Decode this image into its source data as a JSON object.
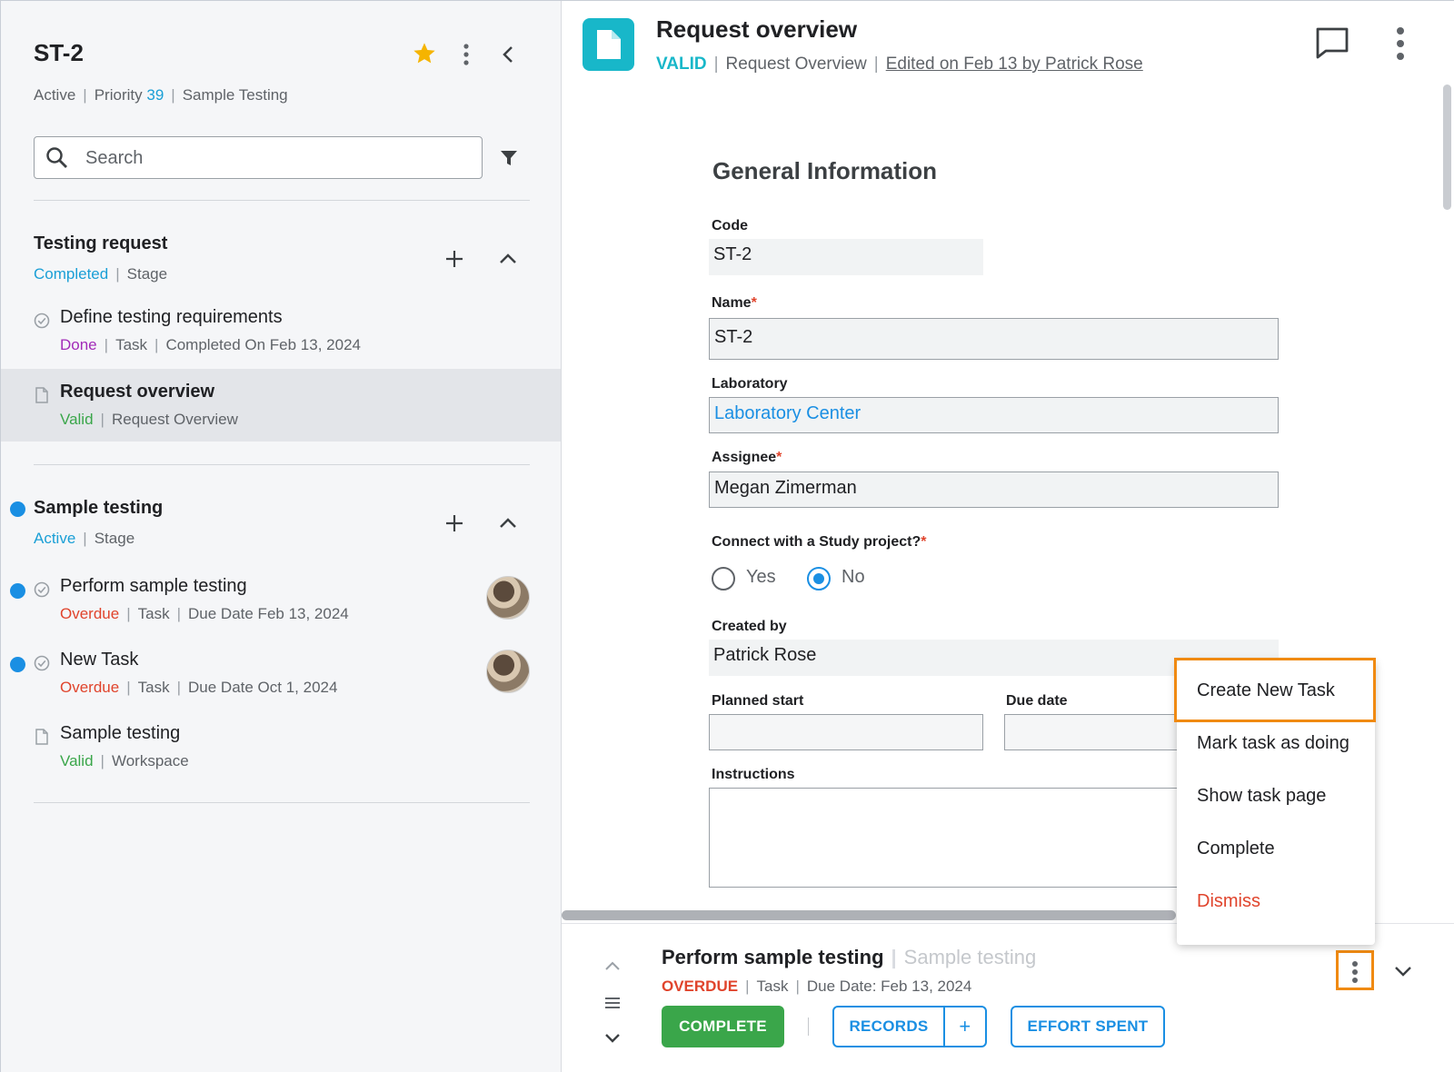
{
  "left": {
    "title": "ST-2",
    "meta": {
      "status": "Active",
      "priority_label": "Priority",
      "priority_value": "39",
      "workspace": "Sample Testing"
    },
    "search": {
      "placeholder": "Search",
      "value": ""
    },
    "groups": [
      {
        "title": "Testing request",
        "status": "Completed",
        "type": "Stage",
        "items": [
          {
            "title": "Define testing requirements",
            "status": "Done",
            "type": "Task",
            "detail": "Completed On Feb 13, 2024"
          },
          {
            "title": "Request overview",
            "status": "Valid",
            "type": "Request Overview"
          }
        ]
      },
      {
        "title": "Sample testing",
        "status": "Active",
        "type": "Stage",
        "items": [
          {
            "title": "Perform sample testing",
            "status": "Overdue",
            "type": "Task",
            "detail": "Due Date Feb 13, 2024"
          },
          {
            "title": "New Task",
            "status": "Overdue",
            "type": "Task",
            "detail": "Due Date Oct 1, 2024"
          },
          {
            "title": "Sample testing",
            "status": "Valid",
            "type": "Workspace"
          }
        ]
      }
    ]
  },
  "right": {
    "header": {
      "title": "Request overview",
      "status": "VALID",
      "type": "Request Overview",
      "edited": "Edited on Feb 13 by Patrick Rose"
    },
    "form": {
      "section": "General Information",
      "code_label": "Code",
      "code_value": "ST-2",
      "name_label": "Name",
      "name_value": "ST-2",
      "lab_label": "Laboratory",
      "lab_value": "Laboratory Center",
      "assignee_label": "Assignee",
      "assignee_value": "Megan Zimerman",
      "connect_label": "Connect with a Study project?",
      "connect_yes": "Yes",
      "connect_no": "No",
      "connect_selected": "No",
      "created_label": "Created by",
      "created_value": "Patrick Rose",
      "planned_label": "Planned start",
      "planned_value": "",
      "due_label": "Due date",
      "due_value": "",
      "instructions_label": "Instructions",
      "instructions_value": "",
      "required_mark": "*"
    },
    "menu": {
      "items": [
        "Create New Task",
        "Mark task as doing",
        "Show task page",
        "Complete",
        "Dismiss"
      ]
    },
    "bottom": {
      "title": "Perform sample testing",
      "subtitle": "Sample testing",
      "status": "OVERDUE",
      "type": "Task",
      "detail": "Due Date: Feb 13, 2024",
      "complete_label": "COMPLETE",
      "records_label": "RECORDS",
      "records_add": "+",
      "effort_label": "EFFORT SPENT"
    }
  },
  "separator": "|",
  "colors": {
    "accent_blue": "#1a9fd6",
    "teal": "#18b7c9",
    "green": "#3aa64a",
    "red": "#e0442c",
    "purple": "#a22bb8",
    "highlight_orange": "#f08a12",
    "star": "#f5b400"
  },
  "icons": [
    "star-icon",
    "kebab-icon",
    "chevron-left-icon",
    "search-icon",
    "filter-icon",
    "plus-icon",
    "chevron-up-icon",
    "check-circle-icon",
    "document-icon",
    "chat-icon",
    "chevron-down-icon",
    "menu-lines-icon"
  ]
}
